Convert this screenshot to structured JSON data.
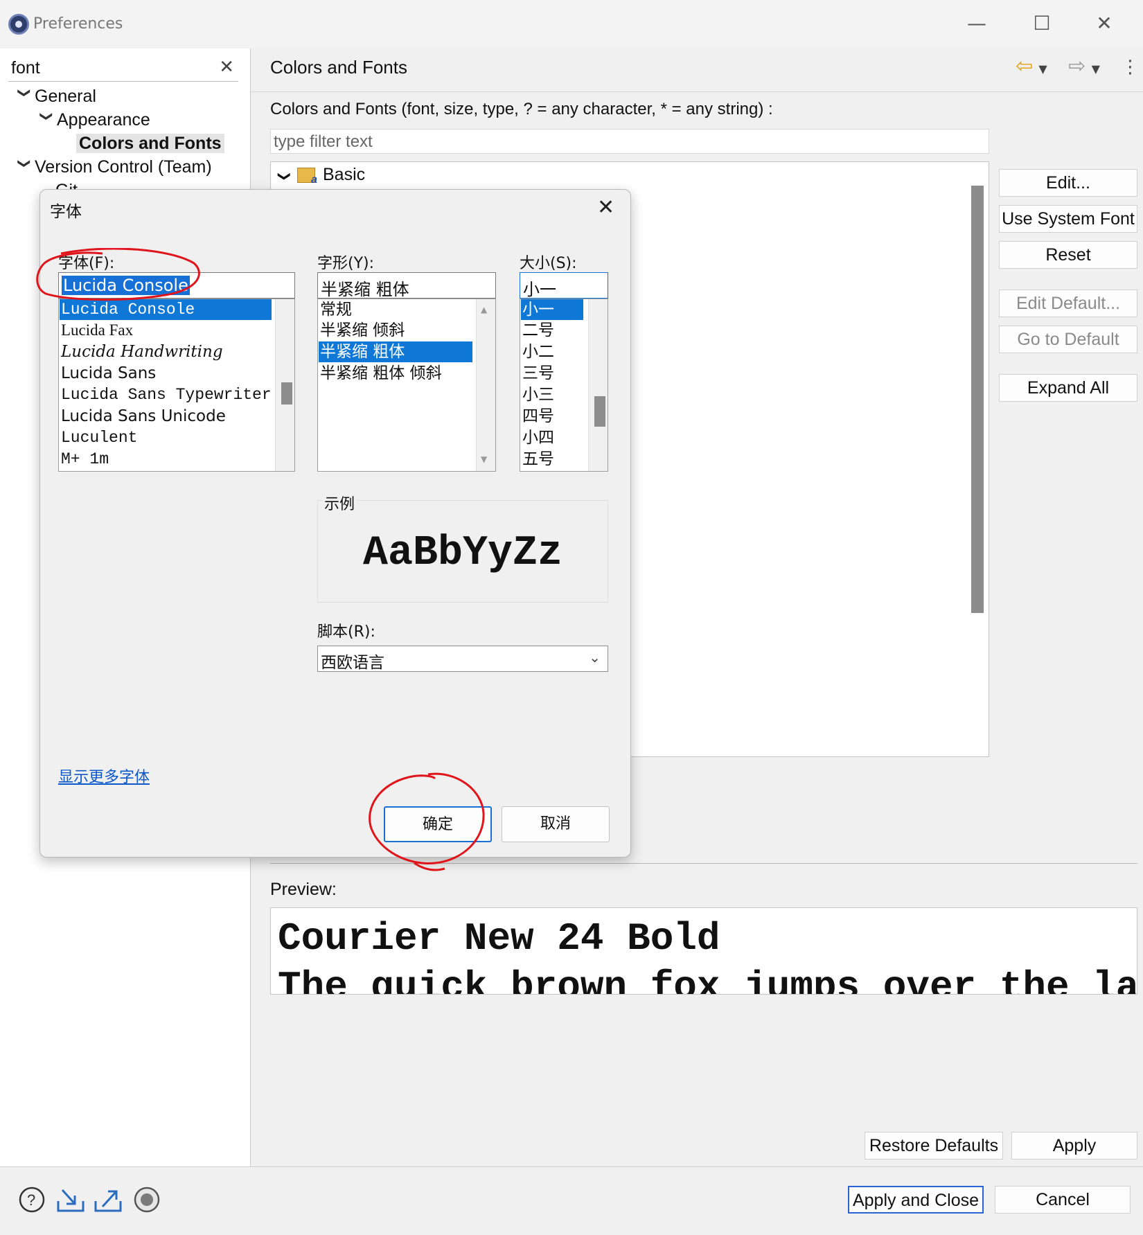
{
  "window": {
    "title": "Preferences",
    "controls": [
      "—",
      "☐",
      "✕"
    ]
  },
  "left": {
    "search_value": "font",
    "clear_icon": "✕",
    "tree": [
      {
        "label": "General",
        "chevron": "❯"
      },
      {
        "label": "Appearance",
        "chevron": "❯"
      },
      {
        "label": "Colors and Fonts"
      },
      {
        "label": "Version Control (Team)",
        "chevron": "❯"
      },
      {
        "label": "Git"
      }
    ]
  },
  "right": {
    "title": "Colors and Fonts",
    "description": "Colors and Fonts (font, size, type, ? = any character, * = any string) :",
    "filter_placeholder": "type filter text",
    "tree_root": "Basic",
    "buttons": {
      "edit": "Edit...",
      "use_system_font": "Use System Font",
      "reset": "Reset",
      "edit_default": "Edit Default...",
      "go_to_default": "Go to Default",
      "expand_all": "Expand All"
    },
    "preview_label": "Preview:",
    "preview_lines": [
      "Courier New 24 Bold",
      "The quick brown fox jumps over the lazy dog."
    ]
  },
  "footer": {
    "restore_defaults": "Restore Defaults",
    "apply": "Apply",
    "apply_and_close": "Apply and Close",
    "cancel": "Cancel"
  },
  "font_dialog": {
    "title": "字体",
    "font_label": "字体(F):",
    "font_value": "Lucida Console",
    "font_list": [
      "Lucida Console",
      "Lucida Fax",
      "Lucida Handwriting",
      "Lucida Sans",
      "Lucida Sans Typewriter",
      "Lucida Sans Unicode",
      "Luculent",
      "M+ 1m"
    ],
    "style_label": "字形(Y):",
    "style_value": "半紧缩 粗体",
    "style_list": [
      "常规",
      "半紧缩 倾斜",
      "半紧缩 粗体",
      "半紧缩 粗体 倾斜"
    ],
    "size_label": "大小(S):",
    "size_value": "小一",
    "size_list": [
      "小一",
      "二号",
      "小二",
      "三号",
      "小三",
      "四号",
      "小四",
      "五号"
    ],
    "sample_label": "示例",
    "sample_text": "AaBbYyZz",
    "script_label": "脚本(R):",
    "script_value": "西欧语言",
    "more_fonts_link": "显示更多字体",
    "ok": "确定",
    "cancel": "取消"
  },
  "colors": {
    "selection": "#0f78d7",
    "link": "#0a58ca",
    "annotation": "#e0151b",
    "default_button_border": "#2a63d6"
  }
}
